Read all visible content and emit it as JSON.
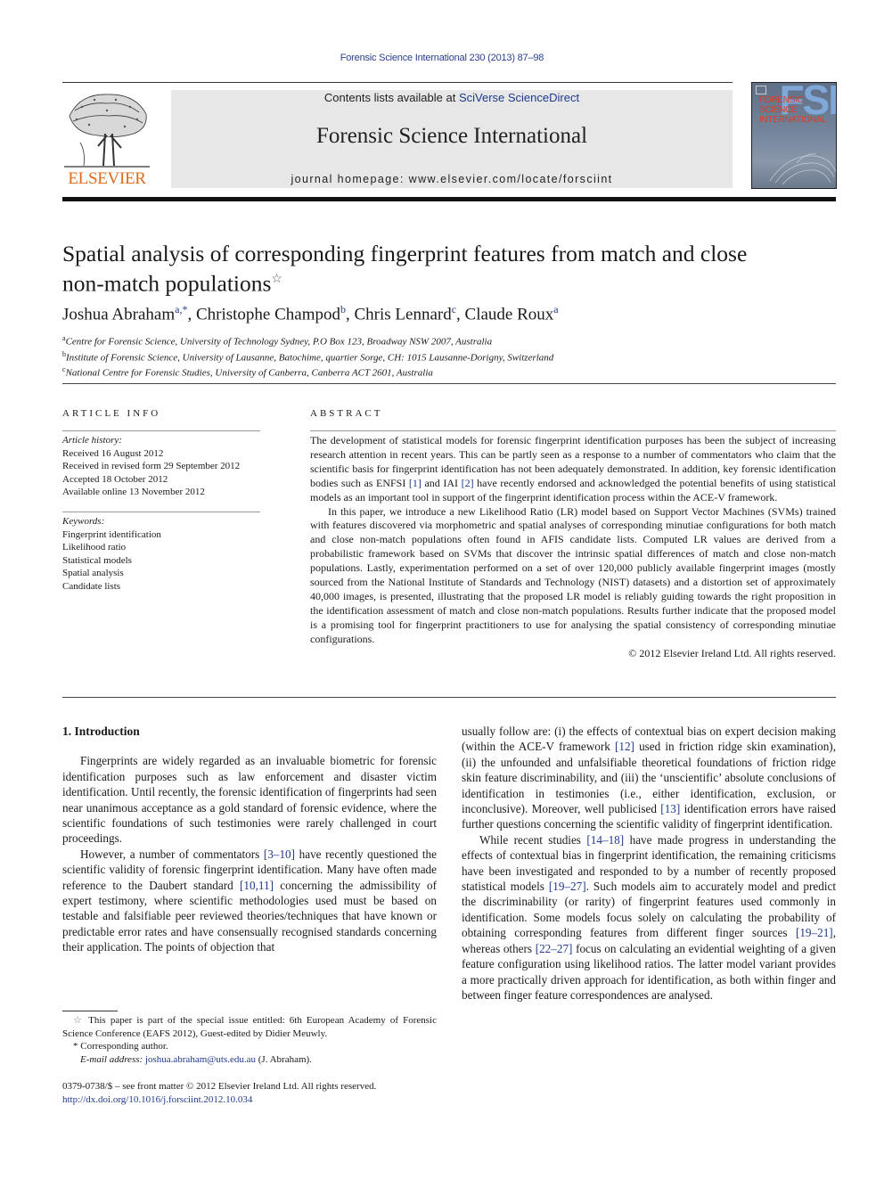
{
  "header": {
    "citation": "Forensic Science International 230 (2013) 87–98",
    "publisher_logo_text": "ELSEVIER",
    "contents_prefix": "Contents lists available at ",
    "contents_link": "SciVerse ScienceDirect",
    "journal_title": "Forensic Science International",
    "homepage": "journal homepage: www.elsevier.com/locate/forsciint",
    "cover": {
      "big_letters": "FSI",
      "title_lines": [
        "FORENSIC",
        "SCIENCE",
        "INTERNATIONAL"
      ]
    }
  },
  "article": {
    "title": "Spatial analysis of corresponding fingerprint features from match and close non-match populations",
    "title_note_mark": "☆",
    "authors": [
      {
        "name": "Joshua Abraham",
        "sup": "a,*"
      },
      {
        "name": "Christophe Champod",
        "sup": "b"
      },
      {
        "name": "Chris Lennard",
        "sup": "c"
      },
      {
        "name": "Claude Roux",
        "sup": "a"
      }
    ],
    "affiliations": [
      {
        "mark": "a",
        "text": "Centre for Forensic Science, University of Technology Sydney, P.O Box 123, Broadway NSW 2007, Australia"
      },
      {
        "mark": "b",
        "text": "Institute of Forensic Science, University of Lausanne, Batochime, quartier Sorge, CH: 1015 Lausanne-Dorigny, Switzerland"
      },
      {
        "mark": "c",
        "text": "National Centre for Forensic Studies, University of Canberra, Canberra ACT 2601, Australia"
      }
    ]
  },
  "article_info": {
    "heading": "ARTICLE INFO",
    "history_label": "Article history:",
    "history": [
      "Received 16 August 2012",
      "Received in revised form 29 September 2012",
      "Accepted 18 October 2012",
      "Available online 13 November 2012"
    ],
    "keywords_label": "Keywords:",
    "keywords": [
      "Fingerprint identification",
      "Likelihood ratio",
      "Statistical models",
      "Spatial analysis",
      "Candidate lists"
    ]
  },
  "abstract": {
    "heading": "ABSTRACT",
    "p1_a": "The development of statistical models for forensic fingerprint identification purposes has been the subject of increasing research attention in recent years. This can be partly seen as a response to a number of commentators who claim that the scientific basis for fingerprint identification has not been adequately demonstrated. In addition, key forensic identification bodies such as ENFSI ",
    "p1_ref1": "[1]",
    "p1_b": " and IAI ",
    "p1_ref2": "[2]",
    "p1_c": " have recently endorsed and acknowledged the potential benefits of using statistical models as an important tool in support of the fingerprint identification process within the ACE-V framework.",
    "p2": "In this paper, we introduce a new Likelihood Ratio (LR) model based on Support Vector Machines (SVMs) trained with features discovered via morphometric and spatial analyses of corresponding minutiae configurations for both match and close non-match populations often found in AFIS candidate lists. Computed LR values are derived from a probabilistic framework based on SVMs that discover the intrinsic spatial differences of match and close non-match populations. Lastly, experimentation performed on a set of over 120,000 publicly available fingerprint images (mostly sourced from the National Institute of Standards and Technology (NIST) datasets) and a distortion set of approximately 40,000 images, is presented, illustrating that the proposed LR model is reliably guiding towards the right proposition in the identification assessment of match and close non-match populations. Results further indicate that the proposed model is a promising tool for fingerprint practitioners to use for analysing the spatial consistency of corresponding minutiae configurations.",
    "copyright": "© 2012 Elsevier Ireland Ltd. All rights reserved."
  },
  "body": {
    "section_heading": "1.  Introduction",
    "left_p1": "Fingerprints are widely regarded as an invaluable biometric for forensic identification purposes such as law enforcement and disaster victim identification. Until recently, the forensic identification of fingerprints had seen near unanimous acceptance as a gold standard of forensic evidence, where the scientific foundations of such testimonies were rarely challenged in court proceedings.",
    "left_p2_a": "However, a number of commentators ",
    "left_p2_ref1": "[3–10]",
    "left_p2_b": " have recently questioned the scientific validity of forensic fingerprint identification. Many have often made reference to the Daubert standard ",
    "left_p2_ref2": "[10,11]",
    "left_p2_c": " concerning the admissibility of expert testimony, where scientific methodologies used must be based on testable and falsifiable peer reviewed theories/techniques that have known or predictable error rates and have consensually recognised standards concerning their application. The points of objection that",
    "right_p1_a": "usually follow are: (i) the effects of contextual bias on expert decision making (within the ACE-V framework ",
    "right_p1_ref1": "[12]",
    "right_p1_b": " used in friction ridge skin examination), (ii) the unfounded and unfalsifiable theoretical foundations of friction ridge skin feature discriminability, and (iii) the ‘unscientific’ absolute conclusions of identification in testimonies (i.e., either identification, exclusion, or inconclusive). Moreover, well publicised ",
    "right_p1_ref2": "[13]",
    "right_p1_c": " identification errors have raised further questions concerning the scientific validity of fingerprint identification.",
    "right_p2_a": "While recent studies ",
    "right_p2_ref1": "[14–18]",
    "right_p2_b": " have made progress in understanding the effects of contextual bias in fingerprint identification, the remaining criticisms have been investigated and responded to by a number of recently proposed statistical models ",
    "right_p2_ref2": "[19–27]",
    "right_p2_c": ". Such models aim to accurately model and predict the discriminability (or rarity) of fingerprint features used commonly in identification. Some models focus solely on calculating the probability of obtaining corresponding features from different finger sources ",
    "right_p2_ref3": "[19–21]",
    "right_p2_d": ", whereas others ",
    "right_p2_ref4": "[22–27]",
    "right_p2_e": " focus on calculating an evidential weighting of a given feature configuration using likelihood ratios. The latter model variant provides a more practically driven approach for identification, as both within finger and between finger feature correspondences are analysed."
  },
  "footnotes": {
    "star_mark": "☆",
    "star_text": " This paper is part of the special issue entitled: 6th European Academy of Forensic Science Conference (EAFS 2012), Guest-edited by Didier Meuwly.",
    "corr_mark": "*",
    "corr_text": " Corresponding author.",
    "email_label": "E-mail address: ",
    "email": "joshua.abraham@uts.edu.au",
    "email_suffix": " (J. Abraham).",
    "issn": "0379-0738/$ – see front matter © 2012 Elsevier Ireland Ltd. All rights reserved.",
    "doi": "http://dx.doi.org/10.1016/j.forsciint.2012.10.034"
  },
  "colors": {
    "link": "#1f3a8a",
    "elsevier_orange": "#e06b1a",
    "banner_bg": "#e7e7e8"
  }
}
